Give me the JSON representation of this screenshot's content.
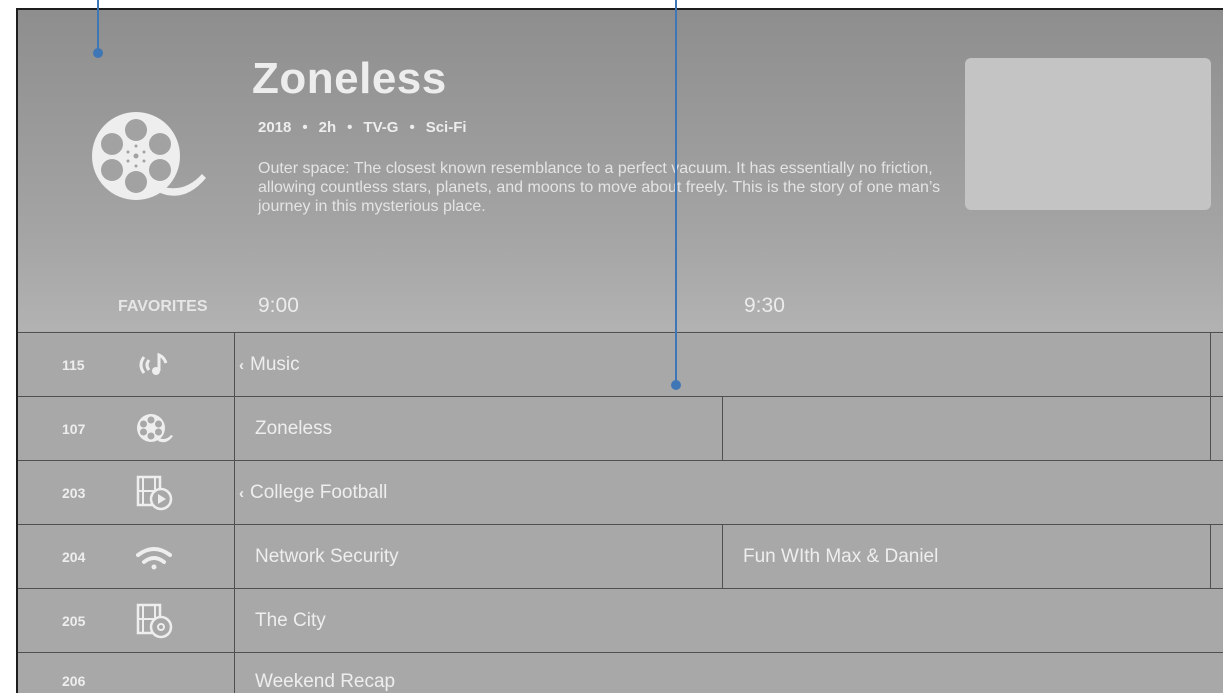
{
  "program": {
    "title": "Zoneless",
    "year": "2018",
    "duration": "2h",
    "rating": "TV-G",
    "genre": "Sci-Fi",
    "description": "Outer space: The closest known resemblance to a perfect vacuum. It has essentially no friction, allowing countless stars, planets, and moons to move about freely. This is the story of one man’s journey in this mysterious place."
  },
  "guide": {
    "favorites_label": "FAVORITES",
    "times": [
      "9:00",
      "9:30"
    ],
    "channels": [
      {
        "number": "115",
        "icon": "music-broadcast-icon",
        "programs": [
          "Music"
        ]
      },
      {
        "number": "107",
        "icon": "film-reel-icon",
        "programs": [
          "Zoneless",
          ""
        ]
      },
      {
        "number": "203",
        "icon": "film-play-icon",
        "programs": [
          "College Football"
        ]
      },
      {
        "number": "204",
        "icon": "wifi-icon",
        "programs": [
          "Network Security",
          "Fun WIth Max & Daniel"
        ]
      },
      {
        "number": "205",
        "icon": "film-disc-icon",
        "programs": [
          "The City"
        ]
      },
      {
        "number": "206",
        "icon": "",
        "programs": [
          "Weekend Recap"
        ]
      }
    ]
  },
  "colors": {
    "annotation": "#3f76b5",
    "grid_line": "#4f4f4f",
    "text": "#eeeeee"
  }
}
